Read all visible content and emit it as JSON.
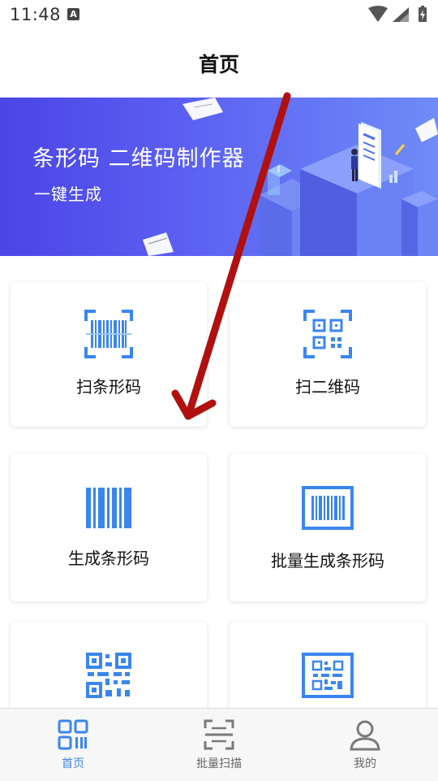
{
  "status_bar": {
    "time": "11:48",
    "notification_letter": "A"
  },
  "header": {
    "title": "首页"
  },
  "banner": {
    "title": "条形码 二维码制作器",
    "subtitle": "一键生成"
  },
  "cards": [
    {
      "label": "扫条形码",
      "icon": "barcode-scan-icon"
    },
    {
      "label": "扫二维码",
      "icon": "qrcode-scan-icon"
    },
    {
      "label": "生成条形码",
      "icon": "barcode-icon"
    },
    {
      "label": "批量生成条形码",
      "icon": "barcode-batch-icon"
    },
    {
      "label": "",
      "icon": "qrcode-icon"
    },
    {
      "label": "",
      "icon": "qrcode-framed-icon"
    }
  ],
  "tabs": [
    {
      "label": "首页",
      "icon": "home-qr-icon",
      "active": true
    },
    {
      "label": "批量扫描",
      "icon": "batch-scan-icon",
      "active": false
    },
    {
      "label": "我的",
      "icon": "profile-icon",
      "active": false
    }
  ],
  "colors": {
    "accent": "#3a86ee",
    "banner_start": "#4b45e6",
    "banner_end": "#6f8cf7",
    "arrow": "#b01010"
  }
}
